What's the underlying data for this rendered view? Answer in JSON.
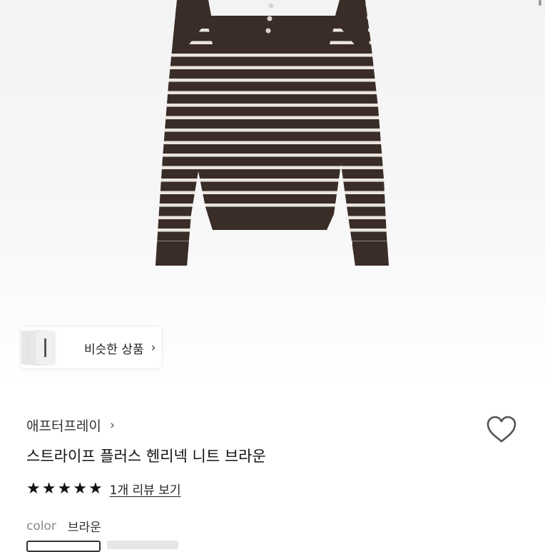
{
  "similar": {
    "label": "비슷한 상품",
    "chevron_icon": "chevron-right-icon"
  },
  "product": {
    "brand": "애프터프레이",
    "title": "스트라이프 플러스 헨리넥 니트 브라운",
    "rating_stars": 5,
    "review_link": "1개 리뷰 보기",
    "option_key": "color",
    "option_value": "브라운"
  },
  "colors": {
    "sweater_base": "#3a2c27",
    "stripe": "#e9e4df",
    "star": "#111111",
    "heart_outline": "#555555"
  },
  "icons": {
    "heart": "heart-outline-icon",
    "star": "star-icon",
    "chevron": "chevron-right-icon"
  }
}
